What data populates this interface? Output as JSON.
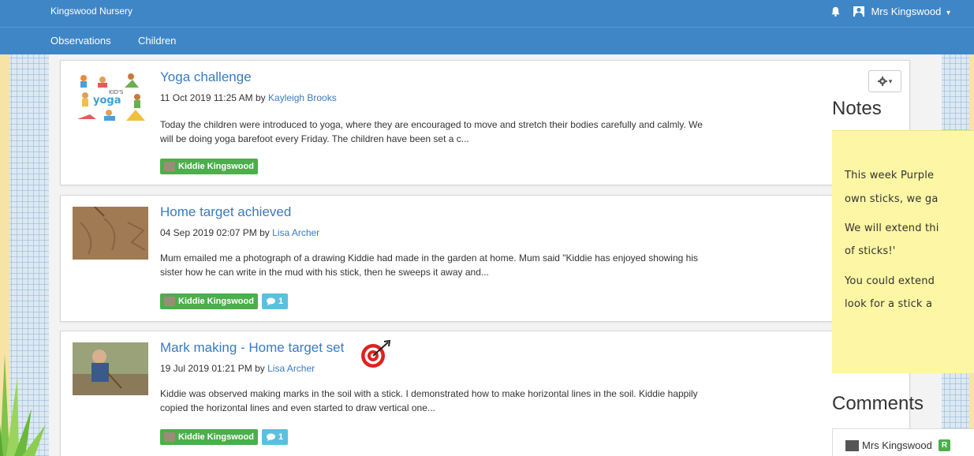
{
  "app": {
    "brand": "Kingswood Nursery"
  },
  "header": {
    "user_name": "Mrs Kingswood",
    "bell_icon": "bell-icon",
    "user_icon": "user-icon",
    "caret": "▾"
  },
  "nav": {
    "items": [
      {
        "label": "Observations"
      },
      {
        "label": "Children"
      }
    ]
  },
  "observations": [
    {
      "title": "Yoga challenge",
      "date": "11 Oct 2019 11:25 AM",
      "by": "by",
      "author": "Kayleigh Brooks",
      "description": "Today the children were introduced to yoga, where they are encouraged to move and stretch their bodies carefully and calmly. We will be doing yoga barefoot every Friday. The children have been set a c...",
      "tag": "Kiddie Kingswood",
      "thumb_text": "KID'S YOGA"
    },
    {
      "title": "Home target achieved",
      "date": "04 Sep 2019 02:07 PM",
      "by": "by",
      "author": "Lisa Archer",
      "description": "Mum emailed me a photograph of a drawing Kiddie had made in the garden at home. Mum said \"Kiddie has enjoyed showing his sister how he can write in the mud with his stick, then he sweeps it away and...",
      "tag": "Kiddie Kingswood",
      "comments": "1"
    },
    {
      "title": "Mark making - Home target set",
      "date": "19 Jul 2019 01:21 PM",
      "by": "by",
      "author": "Lisa Archer",
      "description": "Kiddie was observed making marks in the soil with a stick. I demonstrated how to make horizontal lines in the soil. Kiddie happily copied the horizontal lines and even started to draw vertical one...",
      "tag": "Kiddie Kingswood",
      "comments": "1"
    }
  ],
  "notes": {
    "title": "Notes",
    "lines": [
      "This week Purple",
      "own sticks, we ga",
      "We will extend thi",
      "of sticks!'",
      "You could extend",
      "look for a stick a"
    ]
  },
  "comments": {
    "title": "Comments",
    "first_user": "Mrs Kingswood",
    "first_badge": "R"
  },
  "colors": {
    "primary": "#3f86c6",
    "tag_green": "#4cae4c",
    "comment_blue": "#5bc0de",
    "note_yellow": "#fdf6a4"
  }
}
